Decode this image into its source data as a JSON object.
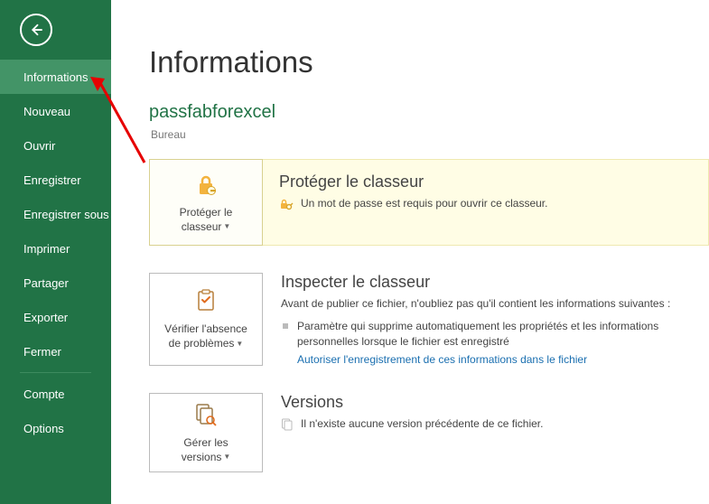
{
  "nav": {
    "items": [
      {
        "label": "Informations",
        "active": true
      },
      {
        "label": "Nouveau"
      },
      {
        "label": "Ouvrir"
      },
      {
        "label": "Enregistrer"
      },
      {
        "label": "Enregistrer sous"
      },
      {
        "label": "Imprimer"
      },
      {
        "label": "Partager"
      },
      {
        "label": "Exporter"
      },
      {
        "label": "Fermer"
      }
    ],
    "bottom": [
      {
        "label": "Compte"
      },
      {
        "label": "Options"
      }
    ]
  },
  "page": {
    "title": "Informations",
    "file_name": "passfabforexcel",
    "file_path": "Bureau"
  },
  "protect": {
    "tile_label_line1": "Protéger le",
    "tile_label_line2": "classeur",
    "title": "Protéger le classeur",
    "desc": "Un mot de passe est requis pour ouvrir ce classeur."
  },
  "inspect": {
    "tile_label_line1": "Vérifier l'absence",
    "tile_label_line2": "de problèmes",
    "title": "Inspecter le classeur",
    "desc": "Avant de publier ce fichier, n'oubliez pas qu'il contient les informations suivantes :",
    "bullet": "Paramètre qui supprime automatiquement les propriétés et les informations personnelles lorsque le fichier est enregistré",
    "link": "Autoriser l'enregistrement de ces informations dans le fichier"
  },
  "versions": {
    "tile_label_line1": "Gérer les",
    "tile_label_line2": "versions",
    "title": "Versions",
    "desc": "Il n'existe aucune version précédente de ce fichier."
  }
}
